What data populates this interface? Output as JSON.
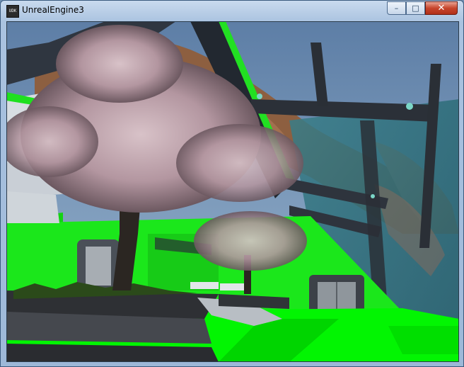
{
  "window": {
    "title": "UnrealEngine3",
    "icon": "udk-logo-icon",
    "icon_text": "UDK",
    "controls": {
      "minimize": "minimize-icon",
      "maximize": "maximize-icon",
      "close": "close-icon"
    }
  },
  "scene": {
    "sky_color": "#6f94bd",
    "wall_color": "#19e619",
    "floor_color": "#00ff00",
    "blossom_color": "#b89aa4",
    "structure_color": "#2a2f36",
    "rock_color": "#9a6a4a"
  }
}
